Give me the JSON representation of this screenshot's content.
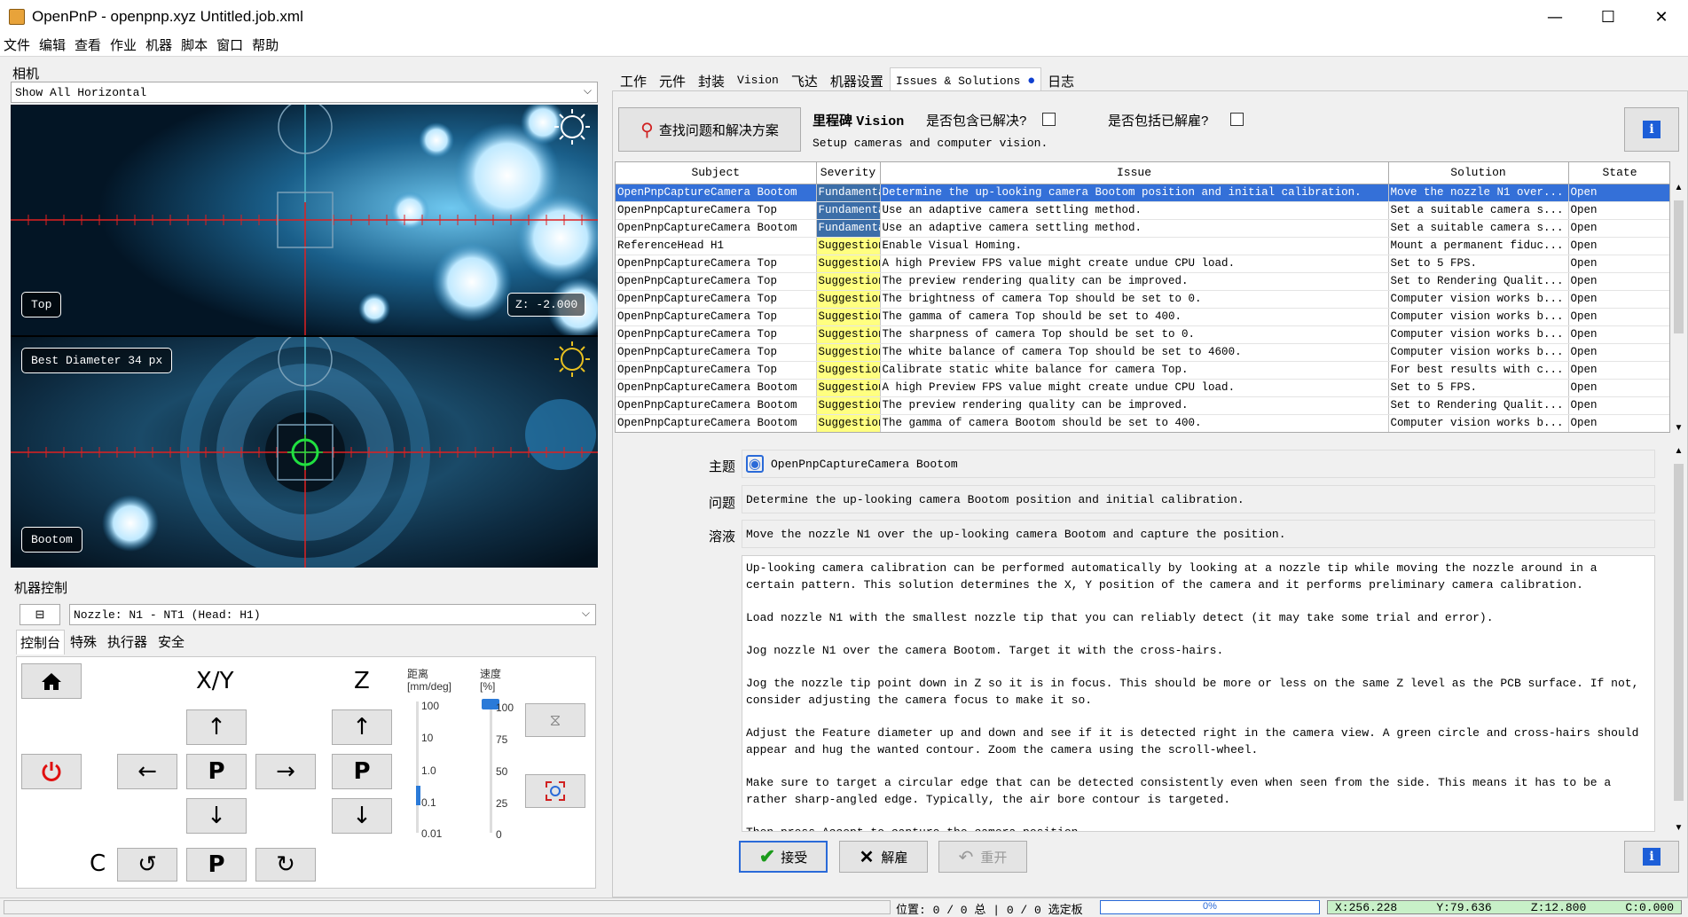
{
  "window": {
    "title": "OpenPnP - openpnp.xyz Untitled.job.xml",
    "minimize": "—",
    "maximize": "☐",
    "close": "✕"
  },
  "menu": [
    "文件",
    "编辑",
    "查看",
    "作业",
    "机器",
    "脚本",
    "窗口",
    "帮助"
  ],
  "cameras": {
    "section_title": "相机",
    "view_mode": "Show All Horizontal",
    "top": {
      "label": "Top",
      "z_readout": "Z: -2.000"
    },
    "bottom": {
      "label": "Bootom",
      "diameter_label": "Best Diameter 34 px"
    }
  },
  "machine_control": {
    "section_title": "机器控制",
    "collapse": "⊟",
    "nozzle": "Nozzle: N1 - NT1 (Head: H1)",
    "tabs": [
      "控制台",
      "特殊",
      "执行器",
      "安全"
    ],
    "xy_label": "X/Y",
    "z_label": "Z",
    "c_label": "C",
    "park": "P",
    "distance_label": "距离",
    "distance_unit": "[mm/deg]",
    "distance_ticks": [
      "100",
      "10",
      "1.0",
      "0.1",
      "0.01"
    ],
    "distance_value": 0.1,
    "speed_label": "速度",
    "speed_unit": "[%]",
    "speed_ticks": [
      "100",
      "75",
      "50",
      "25",
      "0"
    ],
    "speed_value": 100
  },
  "right_tabs": [
    "工作",
    "元件",
    "封装",
    "Vision",
    "飞达",
    "机器设置",
    "Issues & Solutions",
    "日志"
  ],
  "issues": {
    "find_button": "查找问题和解决方案",
    "milestone_label": "里程碑",
    "milestone_name": "Vision",
    "milestone_desc": "Setup cameras and computer vision.",
    "include_solved": "是否包含已解决?",
    "include_dismissed": "是否包括已解雇?",
    "columns": [
      "Subject",
      "Severity",
      "Issue",
      "Solution",
      "State"
    ],
    "rows": [
      [
        "OpenPnpCaptureCamera Bootom",
        "Fundamental",
        "Determine the up-looking camera Bootom position and initial calibration.",
        "Move the nozzle N1 over...",
        "Open"
      ],
      [
        "OpenPnpCaptureCamera Top",
        "Fundamental",
        "Use an adaptive camera settling method.",
        "Set a suitable camera s...",
        "Open"
      ],
      [
        "OpenPnpCaptureCamera Bootom",
        "Fundamental",
        "Use an adaptive camera settling method.",
        "Set a suitable camera s...",
        "Open"
      ],
      [
        "ReferenceHead H1",
        "Suggestion",
        "Enable Visual Homing.",
        "Mount a permanent fiduc...",
        "Open"
      ],
      [
        "OpenPnpCaptureCamera Top",
        "Suggestion",
        "A high Preview FPS value might create undue CPU load.",
        "Set to 5 FPS.",
        "Open"
      ],
      [
        "OpenPnpCaptureCamera Top",
        "Suggestion",
        "The preview rendering quality can be improved.",
        "Set to Rendering Qualit...",
        "Open"
      ],
      [
        "OpenPnpCaptureCamera Top",
        "Suggestion",
        "The brightness of camera Top should be set to 0.",
        "Computer vision works b...",
        "Open"
      ],
      [
        "OpenPnpCaptureCamera Top",
        "Suggestion",
        "The gamma of camera Top should be set to 400.",
        "Computer vision works b...",
        "Open"
      ],
      [
        "OpenPnpCaptureCamera Top",
        "Suggestion",
        "The sharpness of camera Top should be set to 0.",
        "Computer vision works b...",
        "Open"
      ],
      [
        "OpenPnpCaptureCamera Top",
        "Suggestion",
        "The white balance of camera Top should be set to 4600.",
        "Computer vision works b...",
        "Open"
      ],
      [
        "OpenPnpCaptureCamera Top",
        "Suggestion",
        "Calibrate static white balance for camera Top.",
        "For best results with c...",
        "Open"
      ],
      [
        "OpenPnpCaptureCamera Bootom",
        "Suggestion",
        "A high Preview FPS value might create undue CPU load.",
        "Set to 5 FPS.",
        "Open"
      ],
      [
        "OpenPnpCaptureCamera Bootom",
        "Suggestion",
        "The preview rendering quality can be improved.",
        "Set to Rendering Qualit...",
        "Open"
      ],
      [
        "OpenPnpCaptureCamera Bootom",
        "Suggestion",
        "The gamma of camera Bootom should be set to 400.",
        "Computer vision works b...",
        "Open"
      ]
    ],
    "detail": {
      "subject_label": "主题",
      "subject": "OpenPnpCaptureCamera Bootom",
      "issue_label": "问题",
      "issue": "Determine the up-looking camera Bootom position and initial calibration.",
      "solution_label": "溶液",
      "solution": "Move the nozzle N1 over the up-looking camera Bootom and capture the position.",
      "instructions": [
        "Up-looking camera calibration can be performed automatically by looking at a nozzle tip while moving the nozzle around in a certain pattern. This solution determines the X, Y position of the camera and it performs preliminary camera calibration.",
        "Load nozzle N1 with the smallest nozzle tip that you can reliably detect (it may take some trial and error).",
        "Jog nozzle N1 over the camera Bootom. Target it with the cross-hairs.",
        "Jog the nozzle tip point down in Z so it is in focus. This should be more or less on the same Z level as the PCB surface. If not, consider adjusting the camera focus to make it so.",
        "Adjust the Feature diameter up and down and see if it is detected right in the camera view. A green circle and cross-hairs should appear and hug the wanted contour. Zoom the camera using the scroll-wheel.",
        "Make sure to target a circular edge that can be detected consistently even when seen from the side. This means it has to be a rather sharp-angled edge. Typically, the air bore contour is targeted.",
        "Then press Accept to capture the camera position."
      ]
    },
    "accept": "接受",
    "dismiss": "解雇",
    "reopen": "重开"
  },
  "status": {
    "placement": "位置: 0 / 0 总 | 0 / 0 选定板",
    "progress": "0%",
    "progress_value": 0,
    "x": "X:256.228",
    "y": "Y:79.636",
    "z": "Z:12.800",
    "c": "C:0.000"
  },
  "colors": {
    "selection": "#3470d8",
    "fundamental": "#3c6ea8",
    "suggestion": "#ffff80",
    "dro_bg": "#c8f0c8"
  }
}
